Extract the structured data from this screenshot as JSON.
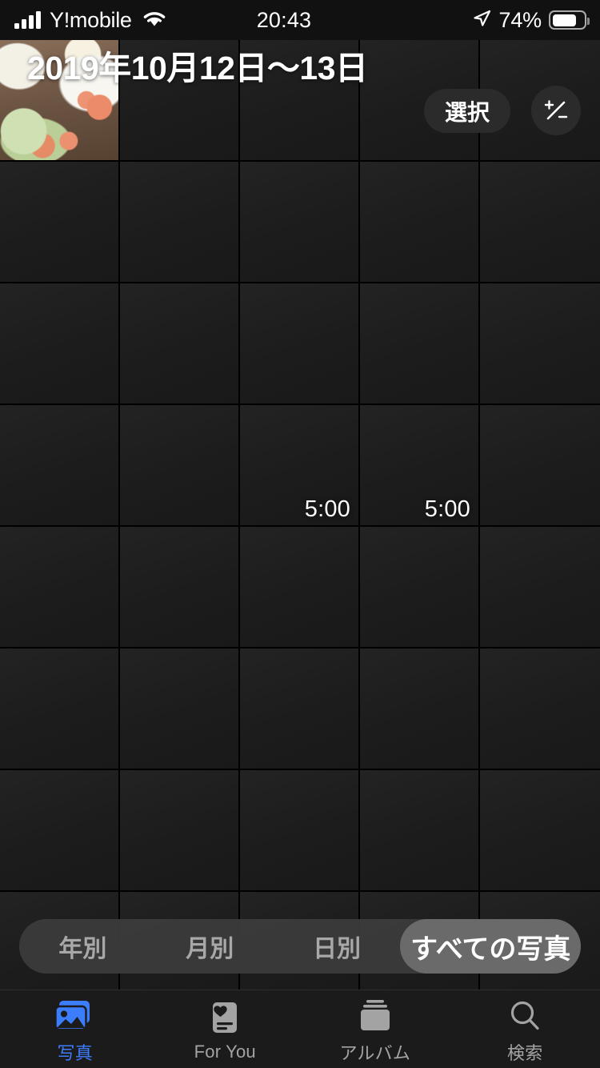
{
  "status_bar": {
    "carrier": "Y!mobile",
    "time": "20:43",
    "battery_percent": "74%",
    "battery_level": 74,
    "signal_bars": 4,
    "wifi_icon": "wifi-icon",
    "location_icon": "location-arrow-icon",
    "battery_icon": "battery-icon"
  },
  "header": {
    "title": "2019年10月12日〜13日",
    "select_label": "選択",
    "zoom_button_icon": "plus-minus-icon"
  },
  "grid": {
    "columns": 5,
    "rows": [
      [
        {
          "type": "photo",
          "name": "food-photo",
          "duration": null
        },
        {
          "type": "placeholder",
          "duration": null
        },
        {
          "type": "placeholder",
          "duration": null
        },
        {
          "type": "placeholder",
          "duration": null
        },
        {
          "type": "placeholder",
          "duration": null
        }
      ],
      [
        {
          "type": "placeholder",
          "duration": null
        },
        {
          "type": "placeholder",
          "duration": null
        },
        {
          "type": "placeholder",
          "duration": null
        },
        {
          "type": "placeholder",
          "duration": null
        },
        {
          "type": "placeholder",
          "duration": null
        }
      ],
      [
        {
          "type": "placeholder",
          "duration": null
        },
        {
          "type": "placeholder",
          "duration": null
        },
        {
          "type": "placeholder",
          "duration": null
        },
        {
          "type": "placeholder",
          "duration": null
        },
        {
          "type": "placeholder",
          "duration": null
        }
      ],
      [
        {
          "type": "placeholder",
          "duration": null
        },
        {
          "type": "placeholder",
          "duration": null
        },
        {
          "type": "video",
          "duration": "5:00"
        },
        {
          "type": "video",
          "duration": "5:00"
        },
        {
          "type": "placeholder",
          "duration": null
        }
      ],
      [
        {
          "type": "placeholder",
          "duration": null
        },
        {
          "type": "placeholder",
          "duration": null
        },
        {
          "type": "placeholder",
          "duration": null
        },
        {
          "type": "placeholder",
          "duration": null
        },
        {
          "type": "placeholder",
          "duration": null
        }
      ],
      [
        {
          "type": "placeholder",
          "duration": null
        },
        {
          "type": "placeholder",
          "duration": null
        },
        {
          "type": "placeholder",
          "duration": null
        },
        {
          "type": "placeholder",
          "duration": null
        },
        {
          "type": "placeholder",
          "duration": null
        }
      ],
      [
        {
          "type": "placeholder",
          "duration": null
        },
        {
          "type": "placeholder",
          "duration": null
        },
        {
          "type": "placeholder",
          "duration": null
        },
        {
          "type": "placeholder",
          "duration": null
        },
        {
          "type": "placeholder",
          "duration": null
        }
      ],
      [
        {
          "type": "placeholder",
          "duration": null
        },
        {
          "type": "placeholder",
          "duration": null
        },
        {
          "type": "placeholder",
          "duration": null
        },
        {
          "type": "placeholder",
          "duration": null
        },
        {
          "type": "placeholder",
          "duration": null
        }
      ]
    ]
  },
  "segmented_control": {
    "selected_index": 3,
    "items": [
      {
        "label": "年別"
      },
      {
        "label": "月別"
      },
      {
        "label": "日別"
      },
      {
        "label": "すべての写真"
      }
    ]
  },
  "tab_bar": {
    "active_index": 0,
    "accent_color": "#3c7dfb",
    "inactive_color": "#a3a3a3",
    "items": [
      {
        "label": "写真",
        "icon": "photos-stack-icon"
      },
      {
        "label": "For You",
        "icon": "for-you-card-icon"
      },
      {
        "label": "アルバム",
        "icon": "albums-stack-icon"
      },
      {
        "label": "検索",
        "icon": "search-magnifier-icon"
      }
    ]
  }
}
